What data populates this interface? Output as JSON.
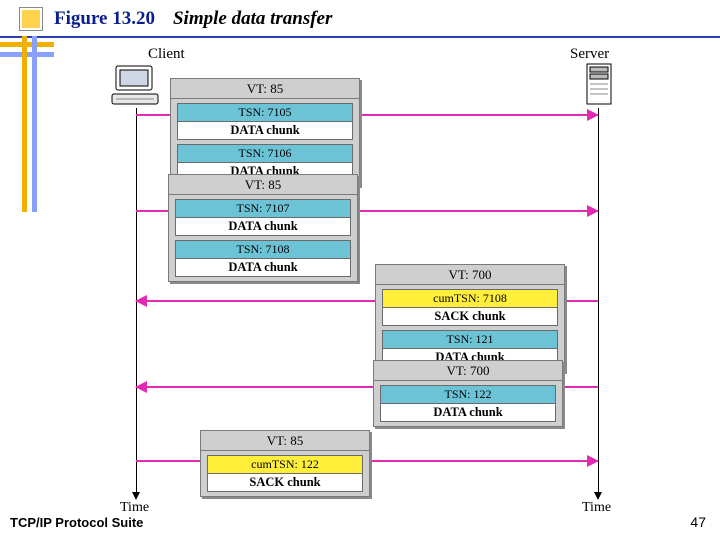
{
  "figure_label": "Figure 13.20",
  "figure_title": "Simple data transfer",
  "client_label": "Client",
  "server_label": "Server",
  "time_label": "Time",
  "footer_left": "TCP/IP Protocol Suite",
  "page_number": "47",
  "groups": {
    "c1": {
      "vt": "VT: 85",
      "chunks": [
        {
          "hdr": "TSN: 7105",
          "body": "DATA chunk"
        },
        {
          "hdr": "TSN: 7106",
          "body": "DATA chunk"
        }
      ]
    },
    "c2": {
      "vt": "VT: 85",
      "chunks": [
        {
          "hdr": "TSN: 7107",
          "body": "DATA chunk"
        },
        {
          "hdr": "TSN: 7108",
          "body": "DATA chunk"
        }
      ]
    },
    "s1": {
      "vt": "VT: 700",
      "chunks": [
        {
          "hdr": "cumTSN: 7108",
          "body": "SACK chunk"
        },
        {
          "hdr": "TSN: 121",
          "body": "DATA chunk"
        }
      ]
    },
    "s2": {
      "vt": "VT: 700",
      "chunks": [
        {
          "hdr": "TSN: 122",
          "body": "DATA chunk"
        }
      ]
    },
    "c3": {
      "vt": "VT: 85",
      "chunks": [
        {
          "hdr": "cumTSN: 122",
          "body": "SACK chunk"
        }
      ]
    }
  }
}
